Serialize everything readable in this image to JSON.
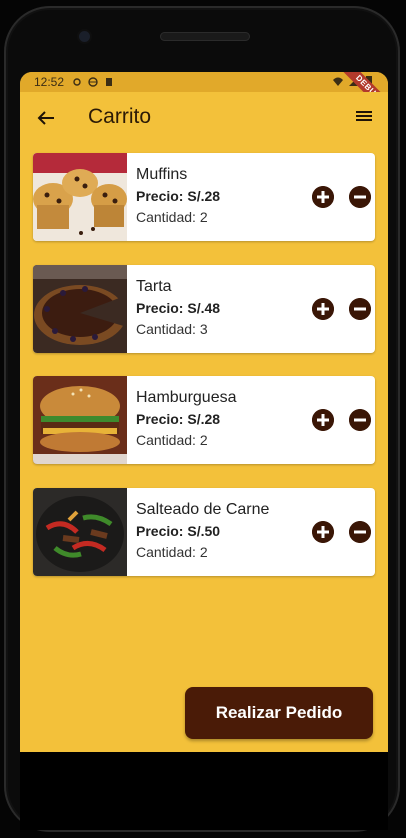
{
  "status": {
    "time": "12:52",
    "debug_label": "DEBUG"
  },
  "appbar": {
    "title": "Carrito",
    "back_icon": "arrow-left-icon",
    "menu_icon": "hamburger-menu-icon"
  },
  "cart": {
    "items": [
      {
        "name": "Muffins",
        "price": "Precio: S/.28",
        "quantity": "Cantidad: 2",
        "image": "muffins-image"
      },
      {
        "name": "Tarta",
        "price": "Precio: S/.48",
        "quantity": "Cantidad: 3",
        "image": "tart-image"
      },
      {
        "name": "Hamburguesa",
        "price": "Precio: S/.28",
        "quantity": "Cantidad: 2",
        "image": "burger-image"
      },
      {
        "name": "Salteado de Carne",
        "price": "Precio: S/.50",
        "quantity": "Cantidad: 2",
        "image": "stir-fry-image"
      }
    ]
  },
  "order_button": {
    "label": "Realizar Pedido"
  },
  "colors": {
    "background": "#f3c13a",
    "accent_dark": "#4a1b07",
    "card": "#ffffff"
  }
}
